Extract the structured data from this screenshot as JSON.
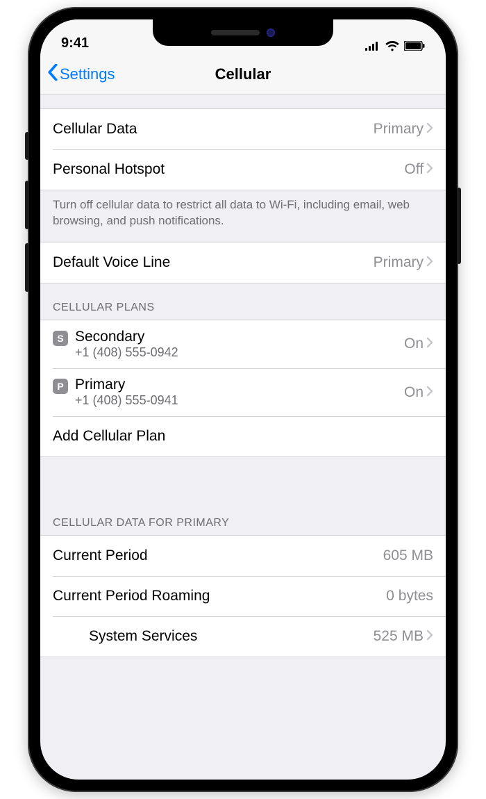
{
  "status": {
    "time": "9:41"
  },
  "nav": {
    "back_label": "Settings",
    "title": "Cellular"
  },
  "rows": {
    "cellular_data": {
      "label": "Cellular Data",
      "value": "Primary"
    },
    "personal_hotspot": {
      "label": "Personal Hotspot",
      "value": "Off"
    },
    "default_voice": {
      "label": "Default Voice Line",
      "value": "Primary"
    }
  },
  "footer": {
    "cellular": "Turn off cellular data to restrict all data to Wi-Fi, including email, web browsing, and push notifications."
  },
  "sections": {
    "plans_header": "CELLULAR PLANS",
    "data_header": "CELLULAR DATA FOR PRIMARY"
  },
  "plans": [
    {
      "badge": "S",
      "name": "Secondary",
      "phone": "+1 (408) 555-0942",
      "status": "On"
    },
    {
      "badge": "P",
      "name": "Primary",
      "phone": "+1 (408) 555-0941",
      "status": "On"
    }
  ],
  "add_plan_label": "Add Cellular Plan",
  "usage": {
    "current_period": {
      "label": "Current Period",
      "value": "605 MB"
    },
    "roaming": {
      "label": "Current Period Roaming",
      "value": "0 bytes"
    },
    "system": {
      "label": "System Services",
      "value": "525 MB"
    }
  }
}
